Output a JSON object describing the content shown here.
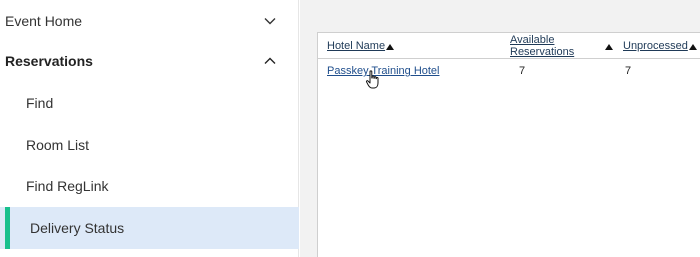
{
  "sidebar": {
    "items": [
      {
        "label": "Event Home",
        "expanded": false,
        "level": "top"
      },
      {
        "label": "Reservations",
        "expanded": true,
        "level": "top"
      },
      {
        "label": "Find",
        "level": "child"
      },
      {
        "label": "Room List",
        "level": "child"
      },
      {
        "label": "Find RegLink",
        "level": "child"
      },
      {
        "label": "Delivery Status",
        "level": "child",
        "active": true
      }
    ],
    "active_accent": "#18c08d",
    "active_background": "#dde9f8"
  },
  "table": {
    "columns": [
      {
        "label": "Hotel Name",
        "sort": "ascending"
      },
      {
        "label_line1": "Available",
        "label_line2": "Reservations",
        "sort": "ascending"
      },
      {
        "label": "Unprocessed",
        "sort": "ascending"
      }
    ],
    "rows": [
      {
        "hotel_name": "Passkey Training Hotel",
        "available_reservations": "7",
        "unprocessed": "7"
      }
    ]
  },
  "icons": {
    "collapse": "chevron-down-icon",
    "expand": "chevron-up-icon",
    "sort": "sort-ascending-icon",
    "cursor": "hand-pointer-icon"
  }
}
